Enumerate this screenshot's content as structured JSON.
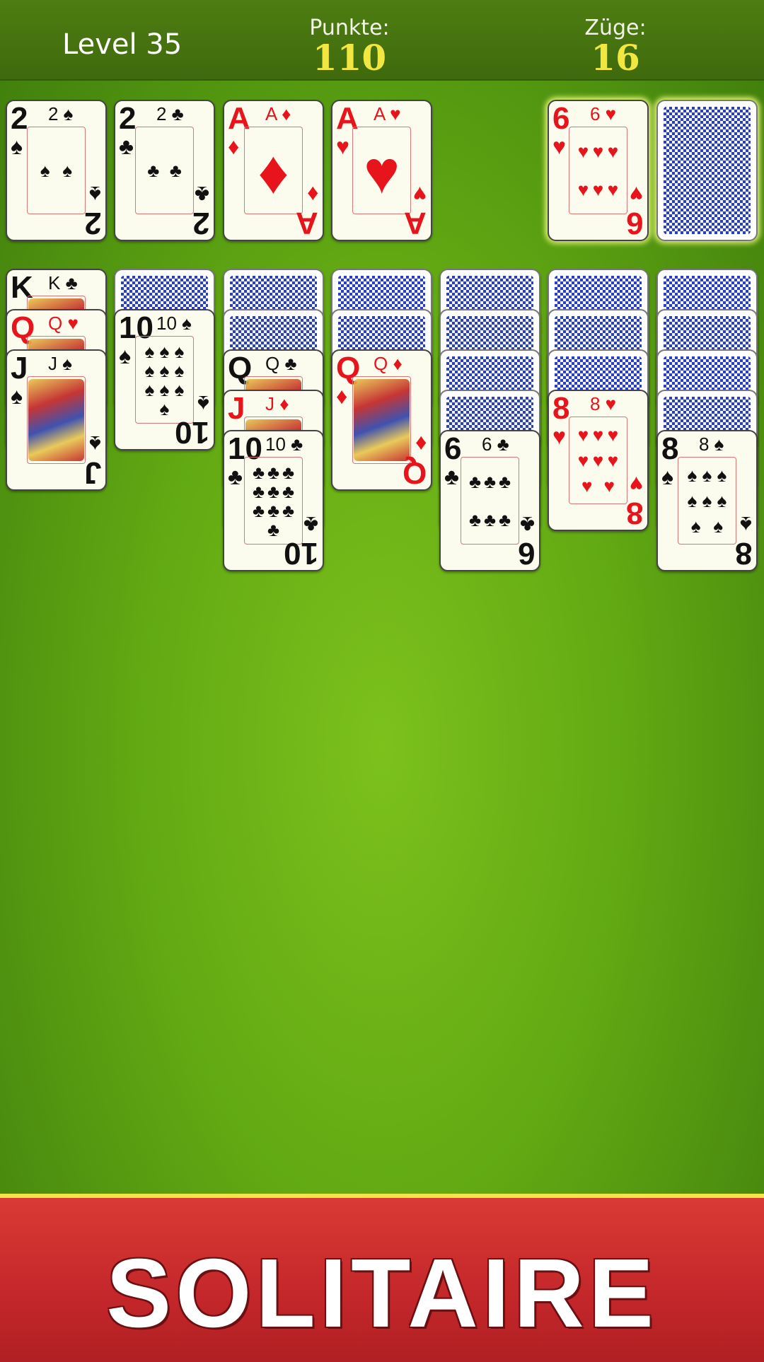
{
  "header": {
    "level": "Level 35",
    "points_label": "Punkte:",
    "points_value": "110",
    "moves_label": "Züge:",
    "moves_value": "16"
  },
  "banner": {
    "title": "SOLITAIRE"
  },
  "colors": {
    "felt": "#6db417",
    "header": "#46740f",
    "score": "#f2e640",
    "banner": "#c9292b",
    "banner_edge": "#f4e44a",
    "card_back": "#2a3ec4"
  },
  "foundations": [
    {
      "rank": "2",
      "suit": "♠",
      "color": "black"
    },
    {
      "rank": "2",
      "suit": "♣",
      "color": "black"
    },
    {
      "rank": "A",
      "suit": "♦",
      "color": "red"
    },
    {
      "rank": "A",
      "suit": "♥",
      "color": "red"
    }
  ],
  "waste": {
    "rank": "6",
    "suit": "♥",
    "color": "red"
  },
  "stock": {
    "face_down": true
  },
  "tableau": [
    {
      "hidden": 0,
      "cards": [
        {
          "rank": "K",
          "suit": "♣",
          "color": "black"
        },
        {
          "rank": "Q",
          "suit": "♥",
          "color": "red"
        },
        {
          "rank": "J",
          "suit": "♠",
          "color": "black"
        }
      ]
    },
    {
      "hidden": 1,
      "cards": [
        {
          "rank": "10",
          "suit": "♠",
          "color": "black"
        }
      ]
    },
    {
      "hidden": 2,
      "cards": [
        {
          "rank": "Q",
          "suit": "♣",
          "color": "black"
        },
        {
          "rank": "J",
          "suit": "♦",
          "color": "red"
        },
        {
          "rank": "10",
          "suit": "♣",
          "color": "black"
        }
      ]
    },
    {
      "hidden": 2,
      "cards": [
        {
          "rank": "Q",
          "suit": "♦",
          "color": "red"
        }
      ]
    },
    {
      "hidden": 4,
      "cards": [
        {
          "rank": "6",
          "suit": "♣",
          "color": "black"
        }
      ]
    },
    {
      "hidden": 3,
      "cards": [
        {
          "rank": "8",
          "suit": "♥",
          "color": "red"
        }
      ]
    },
    {
      "hidden": 4,
      "cards": [
        {
          "rank": "8",
          "suit": "♠",
          "color": "black"
        }
      ]
    }
  ]
}
